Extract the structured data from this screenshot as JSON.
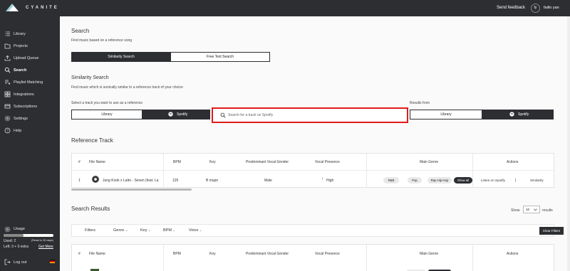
{
  "app": {
    "brand": "CYANITE",
    "feedback": "Send feedback",
    "avatar_initials": "fy",
    "username": "faiilo yan"
  },
  "sidebar": {
    "items": [
      {
        "label": "Library",
        "icon": "list-icon"
      },
      {
        "label": "Projects",
        "icon": "folder-icon"
      },
      {
        "label": "Upload Queue",
        "icon": "upload-icon"
      },
      {
        "label": "Search",
        "icon": "search-icon",
        "active": true
      },
      {
        "label": "Playlist Matching",
        "icon": "playlist-icon"
      },
      {
        "label": "Integrations",
        "icon": "grid-icon"
      },
      {
        "label": "Subscriptions",
        "icon": "card-icon"
      },
      {
        "label": "Settings",
        "icon": "gear-icon"
      },
      {
        "label": "Help",
        "icon": "help-icon"
      }
    ],
    "usage": {
      "title": "Usage",
      "used": "Used: 2",
      "reset": "(Reset in 30 days)",
      "left": "Left: 3 + 0 extra",
      "get_more": "Get More",
      "fraction": 0.4
    },
    "logout": "Log out"
  },
  "search": {
    "title": "Search",
    "subtitle": "Find music based on a reference song",
    "mode_similarity": "Similarity Search",
    "mode_freetext": "Free Text Search"
  },
  "similarity": {
    "title": "Similarity Search",
    "subtitle": "Find music which is sonically similar to a reference track of your choice",
    "select_label": "Select a track you want to use as a reference",
    "source_library": "Library",
    "source_spotify": "Spotify",
    "search_placeholder": "Search for a track on Spotify",
    "results_from": "Results from",
    "results_library": "Library",
    "results_spotify": "Spotify"
  },
  "reference": {
    "title": "Reference Track",
    "columns": [
      "#",
      "File Name",
      "BPM",
      "Key",
      "Predominant Vocal Gender",
      "Vocal Presence",
      "Main Genre",
      "Actions"
    ],
    "row": {
      "num": "1",
      "file": "Jung Kook x Latto - Seven (feat. La",
      "bpm": "125",
      "key": "B major",
      "gender": "Male",
      "presence": "High",
      "genres": [
        "R&B",
        "Pop",
        "Rap Hip-Hop"
      ],
      "show_all": "Show all",
      "action_listen": "Listen on Spotify",
      "action_sep": "|",
      "action_similarity": "Similarity"
    }
  },
  "results": {
    "title": "Search Results",
    "show": "Show",
    "page_size": "10",
    "results_label": "results",
    "filters_label": "Filters",
    "filters": [
      "Genre",
      "Key",
      "BPM",
      "Voice"
    ],
    "clear_filters": "Clear Filters",
    "columns": [
      "#",
      "File Name",
      "BPM",
      "Key",
      "Predominant Vocal Gender",
      "Vocal Presence",
      "Main Genre",
      "Actions"
    ]
  }
}
